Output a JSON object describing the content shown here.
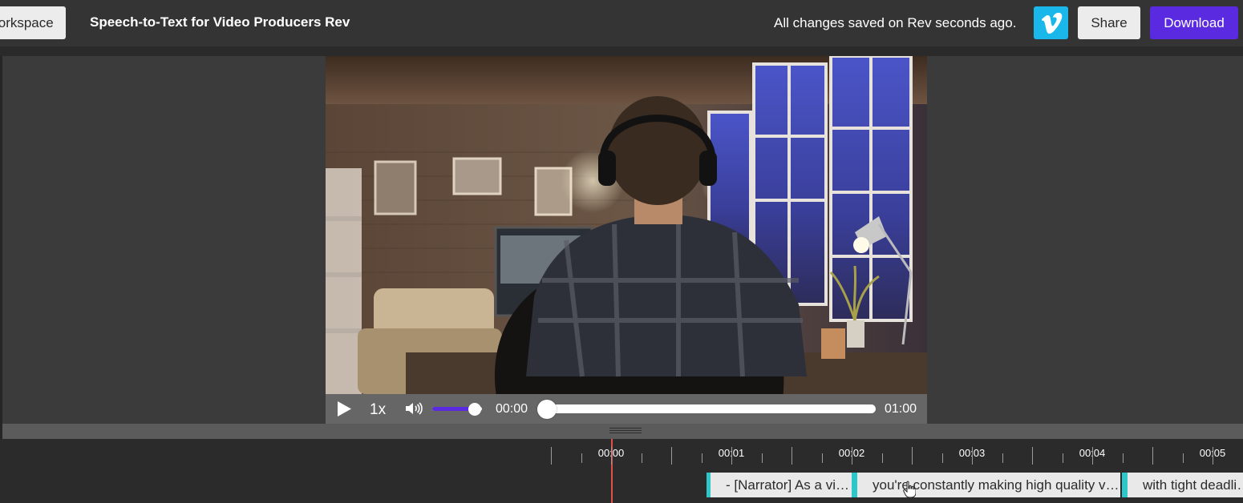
{
  "header": {
    "workspace_label": "Workspace",
    "title": "Speech-to-Text for Video Producers Rev",
    "save_status": "All changes saved on Rev seconds ago.",
    "vimeo_icon": "vimeo-icon",
    "share_label": "Share",
    "download_label": "Download"
  },
  "player": {
    "speed": "1x",
    "current_time": "00:00",
    "total_time": "01:00",
    "volume_level": 0.85,
    "seek_progress": 0.0
  },
  "timeline": {
    "ticks": [
      "00:00",
      "00:01",
      "00:02",
      "00:03",
      "00:04",
      "00:05"
    ],
    "captions": [
      "- [Narrator] As a video producer,",
      "you're constantly making high quality videos",
      "with tight deadlines"
    ]
  },
  "colors": {
    "accent": "#5a2ae0",
    "vimeo": "#1ab7ea",
    "caption_edge": "#2ec7c9",
    "playhead": "#e0504a"
  }
}
